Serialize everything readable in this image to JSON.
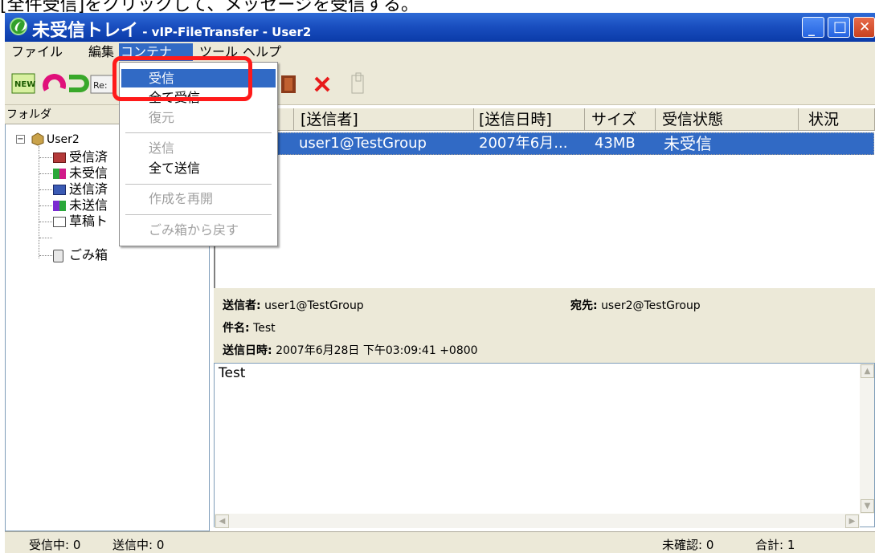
{
  "top_instruction": "[全件受信]をクリックして、メッセージを受信する。",
  "window": {
    "title_main": "未受信トレイ",
    "title_sub": " - vIP-FileTransfer - User2",
    "buttons": {
      "minimize": "_",
      "maximize": "□",
      "close": "✕"
    }
  },
  "menubar": [
    "ファイル",
    "編集",
    "コンテナ",
    "ツール",
    "ヘルプ"
  ],
  "toolbar_buttons": [
    {
      "icon": "new-icon",
      "label": "NEW"
    },
    {
      "icon": "refresh-icon",
      "label": ""
    },
    {
      "icon": "forward-icon",
      "label": ""
    },
    {
      "icon": "reply-icon",
      "label": "Re:"
    },
    {
      "icon": "door-icon",
      "label": ""
    },
    {
      "icon": "delete-icon",
      "label": "×"
    },
    {
      "icon": "properties-icon",
      "label": ""
    }
  ],
  "folders": {
    "header": "フォルダ",
    "root": "User2",
    "items": [
      "受信済",
      "未受信",
      "送信済",
      "未送信",
      "草稿ト",
      "ごみ箱"
    ]
  },
  "columns": [
    "[送信者]",
    "[送信日時]",
    "サイズ",
    "受信状態",
    "状況"
  ],
  "rows": [
    {
      "sender": "user1@TestGroup",
      "date": "2007年6月...",
      "size": "43MB",
      "status": "未受信",
      "situation": ""
    }
  ],
  "detail": {
    "sender_label": "送信者:",
    "sender": "user1@TestGroup",
    "to_label": "宛先:",
    "to": "user2@TestGroup",
    "subject_label": "件名:",
    "subject": "Test",
    "date_label": "送信日時:",
    "date": "2007年6月28日 下午03:09:41 +0800"
  },
  "body": "Test",
  "statusbar": {
    "receiving_label": "受信中:",
    "receiving": "0",
    "sending_label": "送信中:",
    "sending": "0",
    "unconfirmed_label": "未確認:",
    "unconfirmed": "0",
    "total_label": "合計:",
    "total": "1"
  },
  "dropdown": {
    "items": [
      {
        "label": "受信",
        "enabled": true,
        "selected": true
      },
      {
        "label": "全て受信",
        "enabled": true
      },
      {
        "label": "復元",
        "enabled": false
      },
      {
        "label": "送信",
        "enabled": false
      },
      {
        "label": "全て送信",
        "enabled": true
      },
      {
        "label": "作成を再開",
        "enabled": false
      },
      {
        "label": "ごみ箱から戻す",
        "enabled": false
      }
    ]
  },
  "colors": {
    "selection": "#316ac5",
    "titlebar": "#1a4fc0",
    "highlight": "#ff1a1a"
  }
}
